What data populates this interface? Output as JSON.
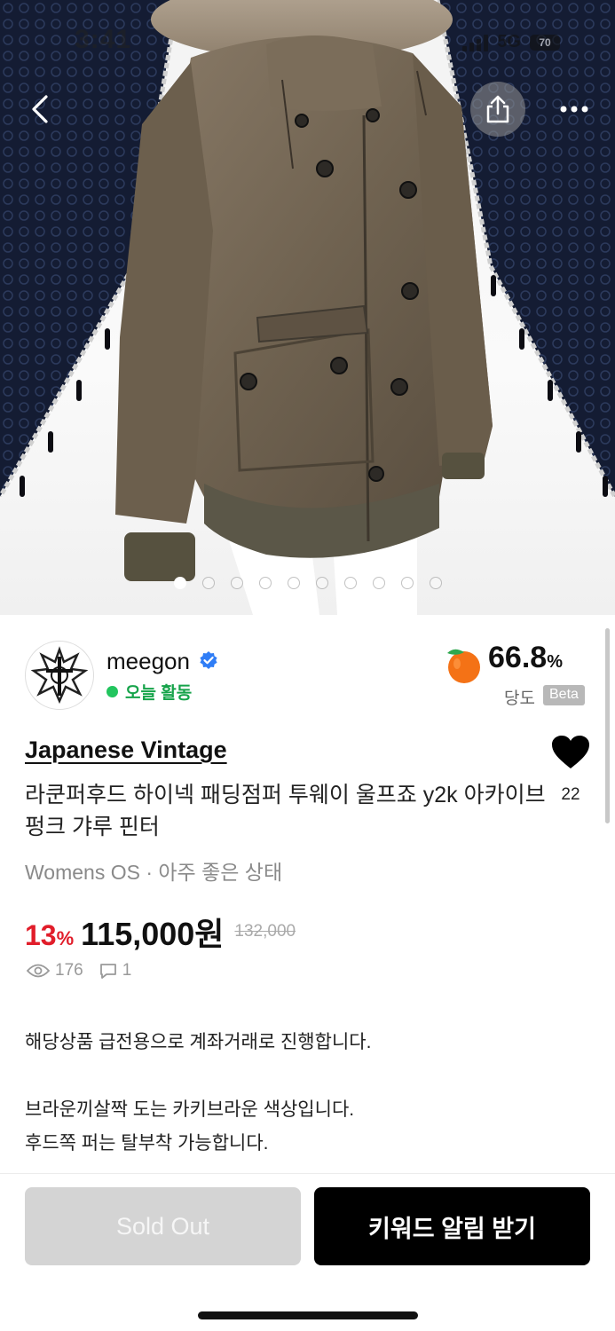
{
  "status_bar": {
    "time": "3:41",
    "network": "5G",
    "battery": "70"
  },
  "hero": {
    "image_alt": "jacket",
    "image_count": 10,
    "active_index": 0
  },
  "seller": {
    "name": "meegon",
    "verified": true,
    "activity": "오늘 활동",
    "score_value": "66.8",
    "score_unit": "%",
    "score_label": "당도",
    "score_badge": "Beta"
  },
  "product": {
    "brand": "Japanese Vintage",
    "title": "라쿤퍼후드 하이넥 패딩점퍼 투웨이 울프죠 y2k 아카이브 펑크 갸루 핀터",
    "meta": "Womens OS · 아주 좋은 상태",
    "discount_value": "13",
    "discount_unit": "%",
    "price": "115,000원",
    "original_price": "132,000",
    "views": "176",
    "comments": "1",
    "likes": "22",
    "description": [
      "해당상품 급전용으로 계좌거래로 진행합니다.",
      "",
      "브라운끼살짝 도는 카키브라운 색상입니다.",
      "후드쪽 퍼는 탈부착 가능합니다."
    ]
  },
  "actions": {
    "sold_out_label": "Sold Out",
    "keyword_alert_label": "키워드 알림 받기"
  },
  "colors": {
    "discount": "#e11d2a",
    "online": "#22c55e",
    "primary_button": "#000000",
    "disabled_button": "#d4d4d4"
  }
}
